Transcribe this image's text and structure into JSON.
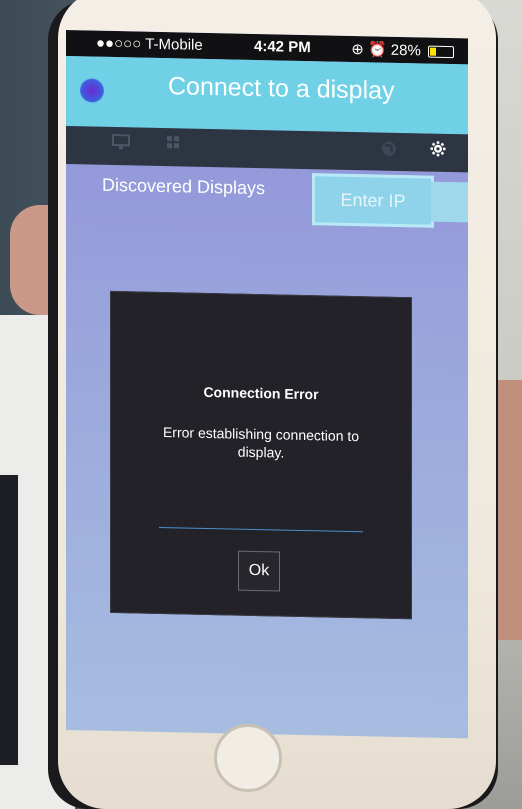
{
  "status_bar": {
    "carrier": "●●○○○ T-Mobile",
    "time": "4:42 PM",
    "battery_percent": "28%",
    "battery_level": 0.28
  },
  "app_bar": {
    "title": "Connect to a display"
  },
  "toolbar": {
    "icons": [
      "display-icon",
      "grid-icon",
      "globe-icon",
      "gear-icon"
    ]
  },
  "tabs": {
    "discovered": "Discovered Displays",
    "enter_ip": "Enter IP"
  },
  "dialog": {
    "title": "Connection Error",
    "message": "Error establishing connection to display.",
    "ok_label": "Ok"
  },
  "colors": {
    "header": "#6fd0e6",
    "toolbar": "#2d3442",
    "dialog": "#222228",
    "accent_line": "#4a8fd0"
  }
}
